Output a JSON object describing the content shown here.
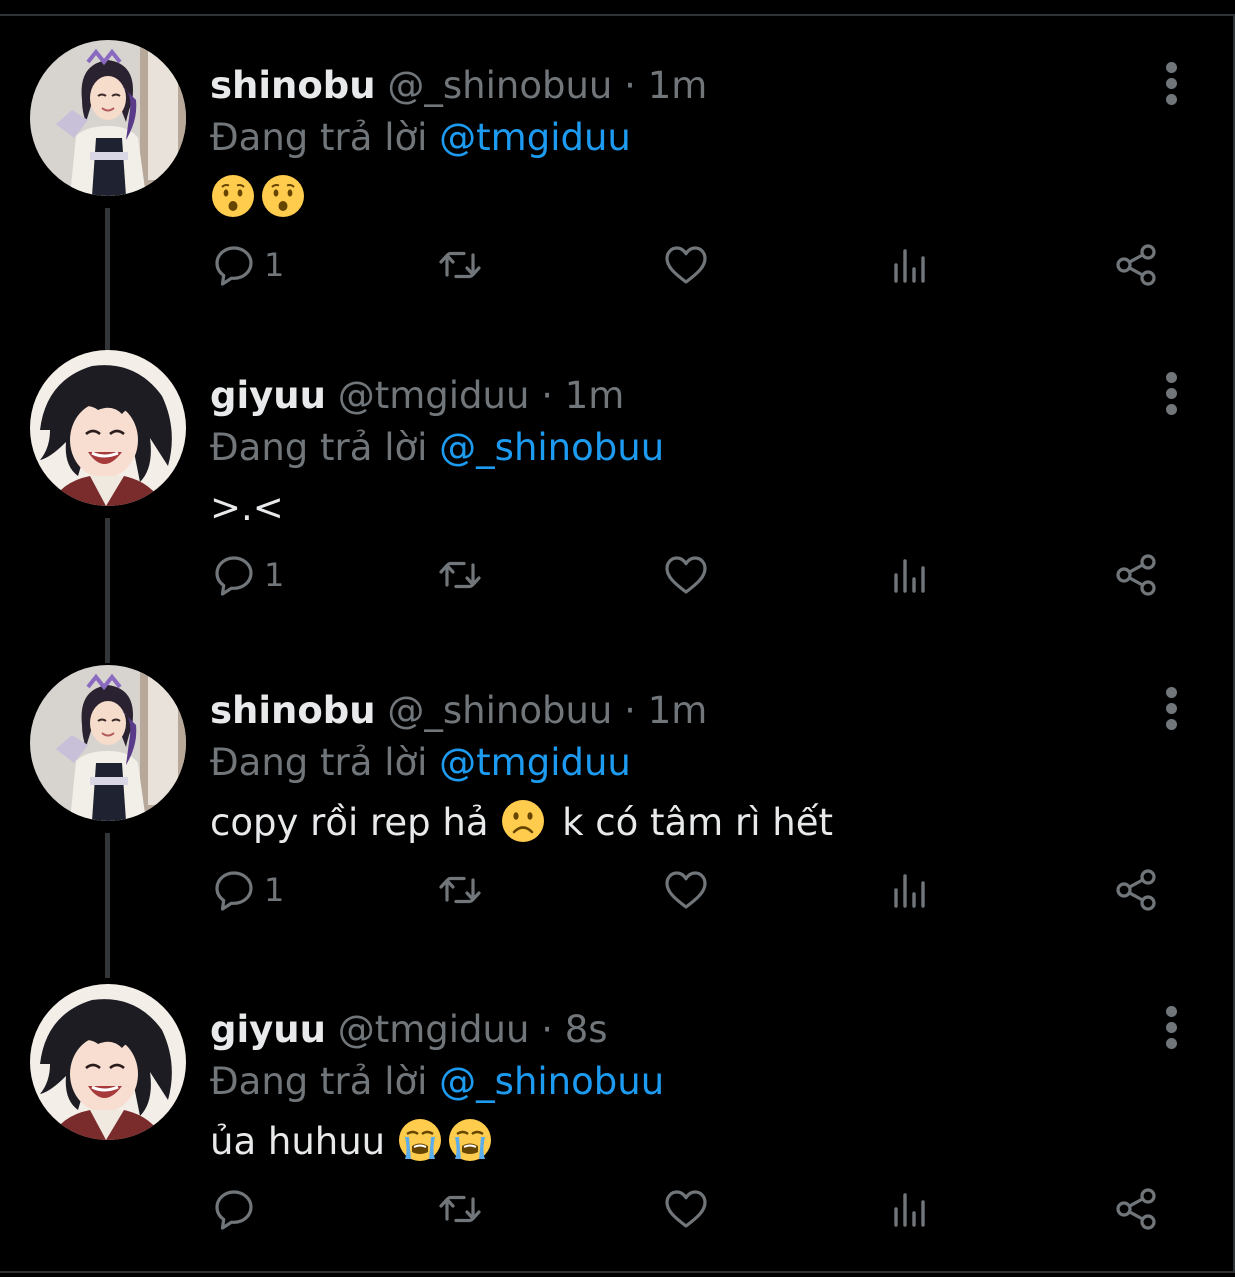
{
  "tweets": [
    {
      "name": "shinobu",
      "handle": "@_shinobuu",
      "separator": "·",
      "time": "1m",
      "reply_prefix": "Đang trả lời",
      "reply_to": "@tmgiduu",
      "text_before": "",
      "text_after": "",
      "emoji": [
        "hushed-face",
        "hushed-face"
      ],
      "reply_count": "1",
      "avatar": "shinobu-avatar"
    },
    {
      "name": "giyuu",
      "handle": "@tmgiduu",
      "separator": "·",
      "time": "1m",
      "reply_prefix": "Đang trả lời",
      "reply_to": "@_shinobuu",
      "text_before": ">.<",
      "text_after": "",
      "emoji": [],
      "reply_count": "1",
      "avatar": "giyuu-avatar"
    },
    {
      "name": "shinobu",
      "handle": "@_shinobuu",
      "separator": "·",
      "time": "1m",
      "reply_prefix": "Đang trả lời",
      "reply_to": "@tmgiduu",
      "text_before": "copy rồi rep hả ",
      "text_after": " k có tâm rì hết",
      "emoji": [
        "slightly-frowning-face"
      ],
      "reply_count": "1",
      "avatar": "shinobu-avatar"
    },
    {
      "name": "giyuu",
      "handle": "@tmgiduu",
      "separator": "·",
      "time": "8s",
      "reply_prefix": "Đang trả lời",
      "reply_to": "@_shinobuu",
      "text_before": "ủa huhuu ",
      "text_after": "",
      "emoji": [
        "loudly-crying-face",
        "loudly-crying-face"
      ],
      "reply_count": "",
      "avatar": "giyuu-avatar"
    }
  ],
  "icons": {
    "reply": "reply-icon",
    "retweet": "retweet-icon",
    "like": "heart-icon",
    "analytics": "analytics-icon",
    "share": "share-icon",
    "more": "more-vertical-icon"
  },
  "colors": {
    "background": "#000000",
    "text": "#e7e9ea",
    "secondary": "#71767b",
    "mention": "#1d9bf0",
    "thread_line": "#333639"
  }
}
